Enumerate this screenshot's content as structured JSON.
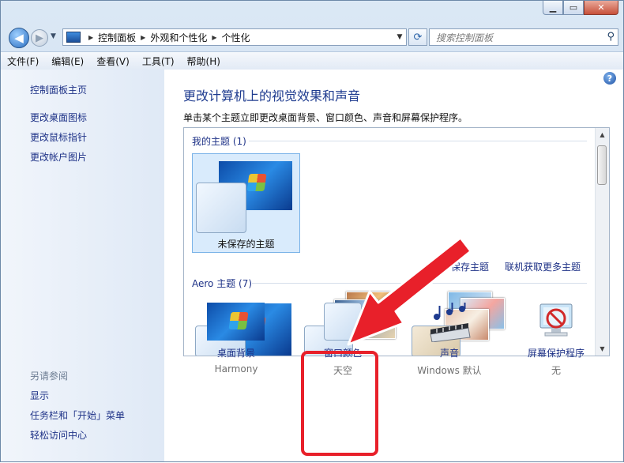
{
  "nav": {
    "breadcrumbs": [
      "控制面板",
      "外观和个性化",
      "个性化"
    ],
    "search_placeholder": "搜索控制面板"
  },
  "menu": [
    "文件(F)",
    "编辑(E)",
    "查看(V)",
    "工具(T)",
    "帮助(H)"
  ],
  "left_pane": {
    "home": "控制面板主页",
    "links": [
      "更改桌面图标",
      "更改鼠标指针",
      "更改帐户图片"
    ],
    "see_also_title": "另请参阅",
    "see_also": [
      "显示",
      "任务栏和「开始」菜单",
      "轻松访问中心"
    ]
  },
  "main": {
    "title": "更改计算机上的视觉效果和声音",
    "description": "单击某个主题立即更改桌面背景、窗口颜色、声音和屏幕保护程序。",
    "my_themes_title": "我的主题 (1)",
    "unsaved_theme": "未保存的主题",
    "save_theme": "保存主题",
    "get_more_themes": "联机获取更多主题",
    "aero_themes_title": "Aero 主题 (7)"
  },
  "bottom": [
    {
      "label": "桌面背景",
      "sub": "Harmony",
      "icon": "desktop-background-icon"
    },
    {
      "label": "窗口颜色",
      "sub": "天空",
      "icon": "window-color-icon"
    },
    {
      "label": "声音",
      "sub": "Windows 默认",
      "icon": "sound-icon"
    },
    {
      "label": "屏幕保护程序",
      "sub": "无",
      "icon": "screensaver-icon"
    }
  ],
  "colors": {
    "link": "#1e3287",
    "title": "#1e3b8f",
    "annotation": "#e8202a"
  }
}
